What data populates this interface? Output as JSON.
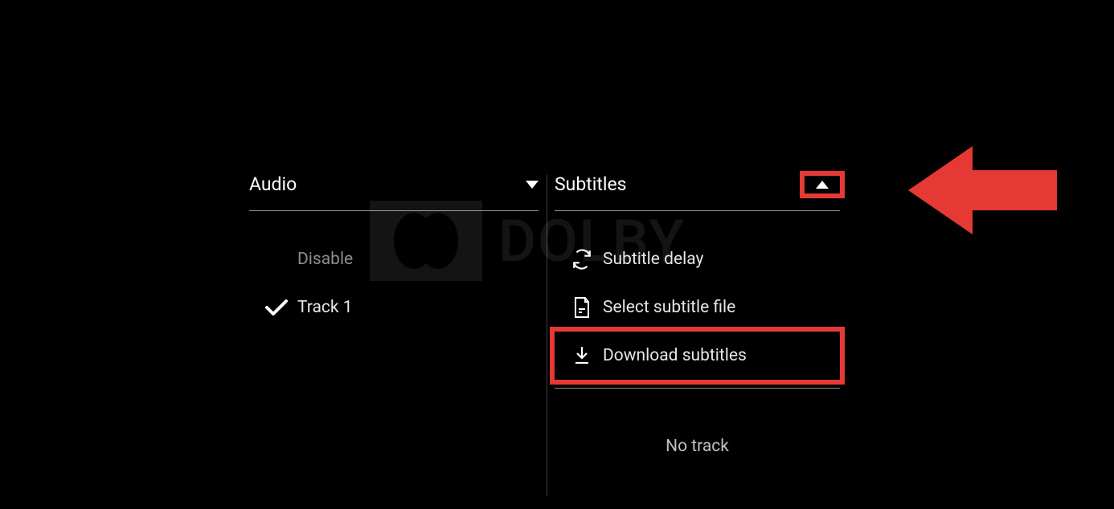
{
  "watermark": {
    "text": "DOLBY"
  },
  "audio": {
    "title": "Audio",
    "items": [
      {
        "label": "Disable",
        "selected": false
      },
      {
        "label": "Track 1",
        "selected": true
      }
    ]
  },
  "subtitles": {
    "title": "Subtitles",
    "actions": [
      {
        "label": "Subtitle delay",
        "icon": "refresh-icon"
      },
      {
        "label": "Select subtitle file",
        "icon": "file-icon"
      },
      {
        "label": "Download subtitles",
        "icon": "download-icon"
      }
    ],
    "no_track_label": "No track"
  },
  "highlight_color": "#e53935"
}
